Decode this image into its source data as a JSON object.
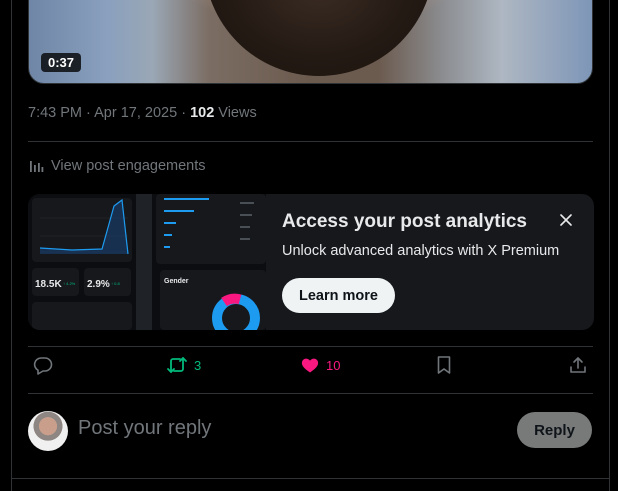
{
  "video": {
    "duration": "0:37"
  },
  "post_meta": {
    "time": "7:43 PM",
    "separator": "·",
    "date": "Apr 17, 2025",
    "views_count": "102",
    "views_label": "Views"
  },
  "engagements": {
    "label": "View post engagements",
    "icon": "bar-chart-icon"
  },
  "promo": {
    "title": "Access your post analytics",
    "subtitle": "Unlock advanced analytics with X Premium",
    "cta": "Learn more",
    "thumbnail": {
      "stat1": "18.5K",
      "stat1_delta": "↑ 4.2%",
      "stat2": "2.9%",
      "stat2_delta": "↑ 0.8",
      "gender_label": "Gender"
    }
  },
  "actions": {
    "reply_icon": "comment-icon",
    "repost_count": "3",
    "like_count": "10",
    "bookmark_icon": "bookmark-icon",
    "share_icon": "share-icon"
  },
  "reply_box": {
    "placeholder": "Post your reply",
    "button": "Reply"
  },
  "colors": {
    "repost": "#00ba7c",
    "like": "#f91880",
    "muted": "#71767b",
    "border": "#2f3336"
  }
}
